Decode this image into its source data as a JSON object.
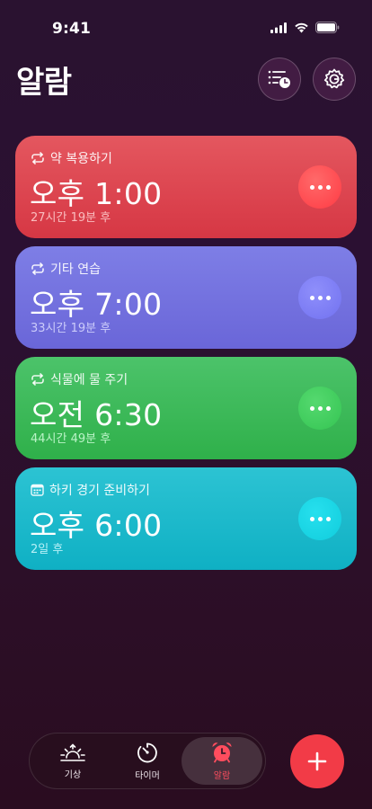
{
  "status_bar": {
    "time": "9:41"
  },
  "header": {
    "title": "알람"
  },
  "alarms": [
    {
      "label": "약 복용하기",
      "label_icon": "repeat-icon",
      "time": "오후 1:00",
      "subtitle": "27시간 19분 후",
      "color": "#dd4451"
    },
    {
      "label": "기타 연습",
      "label_icon": "repeat-icon",
      "time": "오후 7:00",
      "subtitle": "33시간 19분 후",
      "color": "#7473df"
    },
    {
      "label": "식물에 물 주기",
      "label_icon": "repeat-icon",
      "time": "오전 6:30",
      "subtitle": "44시간 49분 후",
      "color": "#3dba5a"
    },
    {
      "label": "하키 경기 준비하기",
      "label_icon": "calendar-icon",
      "time": "오후 6:00",
      "subtitle": "2일 후",
      "color": "#1dbacb"
    }
  ],
  "tab_bar": {
    "tabs": [
      {
        "label": "기상",
        "icon": "sunrise-icon"
      },
      {
        "label": "타이머",
        "icon": "timer-icon"
      },
      {
        "label": "알람",
        "icon": "alarm-clock-icon",
        "selected": true
      }
    ]
  },
  "colors": {
    "accent": "#f23b47",
    "background": "#2b1030"
  }
}
